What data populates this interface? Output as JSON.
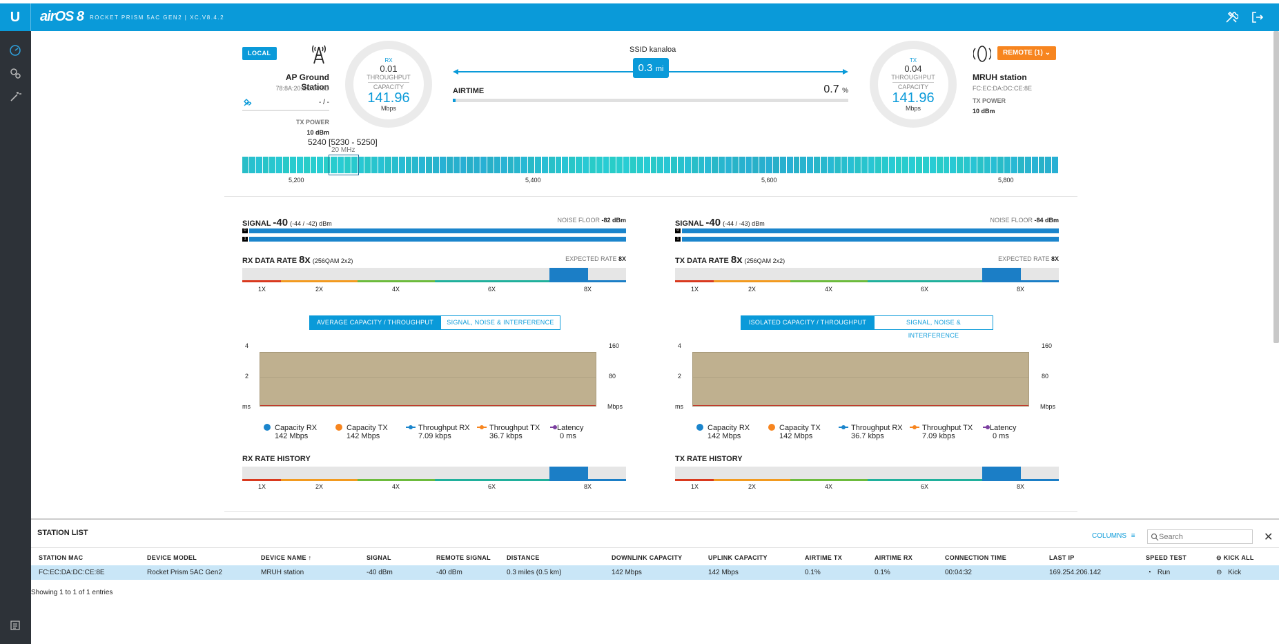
{
  "header": {
    "brand": "airOS 8",
    "model": "ROCKET PRISM 5AC GEN2 | XC.V8.4.2"
  },
  "colors": {
    "accent": "#0a9ad9",
    "remote": "#f7851f",
    "sidebar": "#2d3238"
  },
  "local": {
    "badge": "LOCAL",
    "name": "AP Ground Station",
    "mac": "78:8A:20:EC:30:6D",
    "gps": "- / -",
    "tx_power_label": "TX POWER",
    "tx_power": "10 dBm",
    "frequency": "5240 [5230 - 5250]",
    "width": "20 MHz"
  },
  "rx_ring": {
    "label": "RX",
    "throughput_value": "0.01",
    "throughput_label": "THROUGHPUT",
    "capacity_label": "CAPACITY",
    "capacity": "141.96",
    "unit": "Mbps"
  },
  "tx_ring": {
    "label": "TX",
    "throughput_value": "0.04",
    "throughput_label": "THROUGHPUT",
    "capacity_label": "CAPACITY",
    "capacity": "141.96",
    "unit": "Mbps"
  },
  "link": {
    "ssid": "SSID kanaloa",
    "distance": "0.3",
    "distance_unit": "mi",
    "airtime_label": "AIRTIME",
    "airtime": "0.7",
    "airtime_unit": "%",
    "airtime_fraction": 0.007
  },
  "remote": {
    "badge": "REMOTE (1)",
    "name": "MRUH station",
    "mac": "FC:EC:DA:DC:CE:8E",
    "tx_power_label": "TX POWER",
    "tx_power": "10 dBm"
  },
  "spectrum": {
    "ticks": [
      "5,200",
      "5,400",
      "5,600",
      "5,800"
    ]
  },
  "left": {
    "signal_label": "SIGNAL",
    "signal": "-40",
    "signal_detail": "(-44 / -42) dBm",
    "noise_label": "NOISE FLOOR",
    "noise": "-82 dBm",
    "rate_label": "RX DATA RATE",
    "rate": "8x",
    "rate_detail": "(256QAM 2x2)",
    "expected_label": "EXPECTED RATE",
    "expected": "8X",
    "rate_ticks": [
      "1X",
      "2X",
      "4X",
      "6X",
      "8X"
    ],
    "tab_active": "AVERAGE CAPACITY / THROUGHPUT",
    "tab_inactive": "SIGNAL, NOISE & INTERFERENCE",
    "y_left": [
      "4",
      "2",
      "ms"
    ],
    "y_right": [
      "160",
      "80",
      "Mbps"
    ],
    "legend": [
      {
        "name": "Capacity RX",
        "value": "142 Mbps"
      },
      {
        "name": "Capacity TX",
        "value": "142 Mbps"
      },
      {
        "name": "Throughput RX",
        "value": "7.09 kbps"
      },
      {
        "name": "Throughput TX",
        "value": "36.7 kbps"
      },
      {
        "name": "Latency",
        "value": "0 ms"
      }
    ],
    "history_label": "RX RATE HISTORY"
  },
  "right": {
    "signal_label": "SIGNAL",
    "signal": "-40",
    "signal_detail": "(-44 / -43) dBm",
    "noise_label": "NOISE FLOOR",
    "noise": "-84 dBm",
    "rate_label": "TX DATA RATE",
    "rate": "8x",
    "rate_detail": "(256QAM 2x2)",
    "expected_label": "EXPECTED RATE",
    "expected": "8X",
    "rate_ticks": [
      "1X",
      "2X",
      "4X",
      "6X",
      "8X"
    ],
    "tab_active": "ISOLATED CAPACITY / THROUGHPUT",
    "tab_inactive": "SIGNAL, NOISE & INTERFERENCE",
    "y_left": [
      "4",
      "2",
      "ms"
    ],
    "y_right": [
      "160",
      "80",
      "Mbps"
    ],
    "legend": [
      {
        "name": "Capacity RX",
        "value": "142 Mbps"
      },
      {
        "name": "Capacity TX",
        "value": "142 Mbps"
      },
      {
        "name": "Throughput RX",
        "value": "36.7 kbps"
      },
      {
        "name": "Throughput TX",
        "value": "7.09 kbps"
      },
      {
        "name": "Latency",
        "value": "0 ms"
      }
    ],
    "history_label": "TX RATE HISTORY"
  },
  "stations": {
    "title": "STATION LIST",
    "columns_btn": "COLUMNS",
    "search_placeholder": "Search",
    "headers": [
      "STATION MAC",
      "DEVICE MODEL",
      "DEVICE NAME",
      "SIGNAL",
      "REMOTE SIGNAL",
      "DISTANCE",
      "DOWNLINK CAPACITY",
      "UPLINK CAPACITY",
      "AIRTIME TX",
      "AIRTIME RX",
      "CONNECTION TIME",
      "LAST IP",
      "SPEED TEST"
    ],
    "kick_all": "KICK ALL",
    "row": [
      "FC:EC:DA:DC:CE:8E",
      "Rocket Prism 5AC Gen2",
      "MRUH station",
      "-40 dBm",
      "-40 dBm",
      "0.3 miles (0.5 km)",
      "142 Mbps",
      "142 Mbps",
      "0.1%",
      "0.1%",
      "00:04:32",
      "169.254.206.142"
    ],
    "run": "Run",
    "kick": "Kick",
    "footer": "Showing 1 to 1 of 1 entries"
  }
}
